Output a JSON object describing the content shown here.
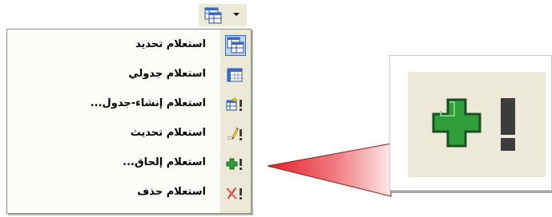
{
  "toolbar": {
    "button_icon": "query-table-icon",
    "dropdown_icon": "chevron-down-icon"
  },
  "menu": {
    "items": [
      {
        "label": "استعلام تحديد",
        "icon": "select-query-icon",
        "highlighted": true
      },
      {
        "label": "استعلام جدولي",
        "icon": "crosstab-query-icon"
      },
      {
        "label": "استعلام إنشاء-جدول...",
        "icon": "make-table-query-icon"
      },
      {
        "label": "استعلام تحديث",
        "icon": "update-query-icon"
      },
      {
        "label": "استعلام إلحاق...",
        "icon": "append-query-icon"
      },
      {
        "label": "استعلام حذف",
        "icon": "delete-query-icon"
      }
    ]
  },
  "zoom": {
    "icon": "append-query-icon"
  },
  "colors": {
    "menu_background": "#fcfcf9",
    "menu_strip": "#ece9d8",
    "highlight_fill": "#c1d2ee",
    "highlight_border": "#316ac5",
    "plus_green": "#2e9e3a",
    "bang_gray": "#3c3c3c",
    "pointer_red": "#e41f2a"
  }
}
